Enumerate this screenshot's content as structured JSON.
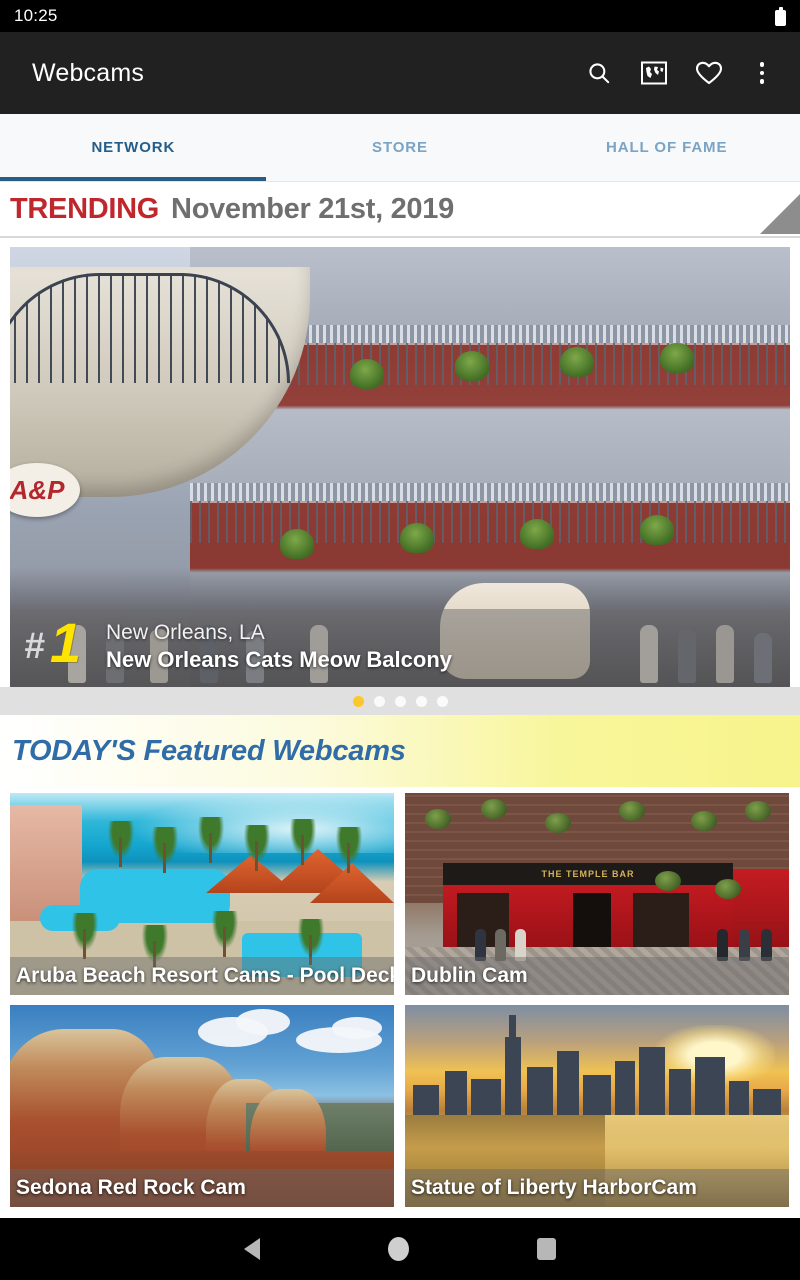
{
  "status_bar": {
    "clock": "10:25",
    "battery_icon": "battery-icon"
  },
  "app_bar": {
    "title": "Webcams",
    "icons": [
      {
        "name": "search-icon",
        "label": "Search"
      },
      {
        "name": "world-map-icon",
        "label": "Map"
      },
      {
        "name": "heart-icon",
        "label": "Favorites"
      },
      {
        "name": "overflow-menu-icon",
        "label": "More options"
      }
    ]
  },
  "tabs": {
    "items": [
      {
        "label": "NETWORK",
        "active": true
      },
      {
        "label": "STORE",
        "active": false
      },
      {
        "label": "HALL OF FAME",
        "active": false
      }
    ]
  },
  "trending": {
    "label": "TRENDING",
    "date": "November 21st, 2019",
    "label_color": "#c0272d",
    "date_color": "#6f6f6f",
    "hero": {
      "rank_hash": "#",
      "rank_number": "1",
      "city": "New Orleans, LA",
      "name": "New Orleans Cats Meow Balcony",
      "sign_text": "A&P"
    },
    "carousel": {
      "total_dots": 5,
      "active_index": 0,
      "active_color": "#fcc72c"
    }
  },
  "featured": {
    "heading": "TODAY'S Featured Webcams",
    "heading_color": "#2f6ca8",
    "cards": [
      {
        "caption": "Aruba Beach Resort Cams - Pool Deck"
      },
      {
        "caption": "Dublin Cam",
        "sign_text": "THE TEMPLE BAR"
      },
      {
        "caption": "Sedona Red Rock Cam"
      },
      {
        "caption": "Statue of Liberty HarborCam"
      }
    ]
  },
  "nav_bar": {
    "buttons": [
      {
        "name": "nav-back-button",
        "label": "Back"
      },
      {
        "name": "nav-home-button",
        "label": "Home"
      },
      {
        "name": "nav-recents-button",
        "label": "Recents"
      }
    ]
  }
}
